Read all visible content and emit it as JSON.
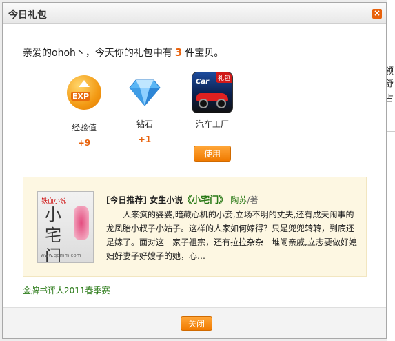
{
  "dialog": {
    "title": "今日礼包",
    "close_icon": "×"
  },
  "greeting": {
    "prefix": "亲爱的ohoh丶，今天你的礼包中有",
    "count": "3",
    "suffix": "件宝贝。"
  },
  "gifts": [
    {
      "name": "经验值",
      "amount": "+9",
      "icon": "exp-icon",
      "icon_text": "EXP"
    },
    {
      "name": "钻石",
      "amount": "+1",
      "icon": "diamond-icon"
    },
    {
      "name": "汽车工厂",
      "amount": "",
      "icon": "car-game-icon",
      "badge": "礼包"
    }
  ],
  "use_button": "使用",
  "recommendation": {
    "tag": "[今日推荐]",
    "category": "女生小说",
    "book": "《小宅门》",
    "author": "陶苏",
    "role": "/著",
    "description": "人来疯的婆婆,暗藏心机的小妾,立场不明的丈夫,还有成天闹事的龙凤胎小叔子小姑子。这样的人家如何嫁得？只是兜兜转转，到底还是嫁了。面对这一家子祖宗，还有拉拉杂杂一堆闹亲戚,立志要做好媳妇好妻子好嫂子的她，心…",
    "cover_brand": "铁血小说",
    "cover_title": "小宅门",
    "cover_url": "www.qdmm.com"
  },
  "link": "金牌书评人2011春季赛",
  "close_button": "关闭",
  "background": {
    "chars": [
      "领",
      "舒",
      "占"
    ]
  },
  "colors": {
    "accent": "#e8620c",
    "green_link": "#2a7a17",
    "rec_bg": "#fdf7e2"
  }
}
